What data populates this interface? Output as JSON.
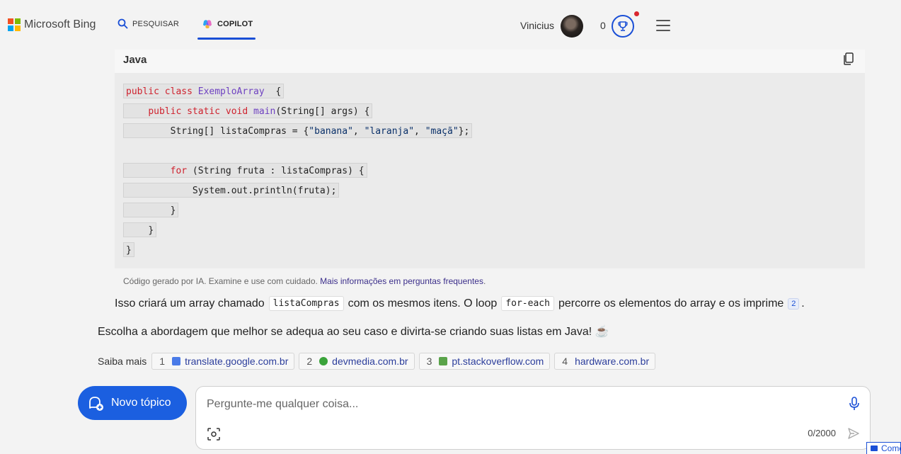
{
  "header": {
    "brand": "Microsoft Bing",
    "tabs": [
      {
        "label": "PESQUISAR",
        "active": false
      },
      {
        "label": "COPILOT",
        "active": true
      }
    ],
    "user_name": "Vinicius",
    "points": "0",
    "accent_color": "#1a4fd6"
  },
  "code_block": {
    "language": "Java",
    "lines": [
      {
        "indent": "",
        "parts": [
          [
            "kw",
            "public class "
          ],
          [
            "ty",
            "ExemploArray"
          ],
          [
            "",
            "  {"
          ]
        ]
      },
      {
        "indent": "    ",
        "parts": [
          [
            "kw",
            "public static void "
          ],
          [
            "ty",
            "main"
          ],
          [
            "",
            "(String[] args) {"
          ]
        ]
      },
      {
        "indent": "        ",
        "parts": [
          [
            "",
            "String[] listaCompras = {"
          ],
          [
            "st",
            "\"banana\""
          ],
          [
            "",
            ", "
          ],
          [
            "st",
            "\"laranja\""
          ],
          [
            "",
            ", "
          ],
          [
            "st",
            "\"maçã\""
          ],
          [
            "",
            "};"
          ]
        ]
      },
      {
        "indent": "",
        "parts": []
      },
      {
        "indent": "        ",
        "parts": [
          [
            "kw",
            "for"
          ],
          [
            "",
            " (String fruta : listaCompras) {"
          ]
        ]
      },
      {
        "indent": "            ",
        "parts": [
          [
            "",
            "System.out.println(fruta);"
          ]
        ]
      },
      {
        "indent": "        ",
        "parts": [
          [
            "",
            "}"
          ]
        ]
      },
      {
        "indent": "    ",
        "parts": [
          [
            "",
            "}"
          ]
        ]
      },
      {
        "indent": "",
        "parts": [
          [
            "",
            "}"
          ]
        ]
      }
    ]
  },
  "disclaimer": {
    "text": "Código gerado por IA. Examine e use com cuidado. ",
    "link": "Mais informações em perguntas frequentes"
  },
  "paragraph1": {
    "before": "Isso criará um array chamado",
    "code1": "listaCompras",
    "middle": "com os mesmos itens. O loop",
    "code2": "for-each",
    "after": "percorre os elementos do array e os imprime",
    "citation": "2",
    "end": "."
  },
  "paragraph2": "Escolha a abordagem que melhor se adequa ao seu caso e divirta-se criando suas listas em Java! ☕",
  "learn_more": {
    "label": "Saiba mais",
    "sources": [
      {
        "num": "1",
        "domain": "translate.google.com.br",
        "icon": "google-translate-icon",
        "color": "#4a7be8"
      },
      {
        "num": "2",
        "domain": "devmedia.com.br",
        "icon": "devmedia-icon",
        "color": "#3aa33a"
      },
      {
        "num": "3",
        "domain": "pt.stackoverflow.com",
        "icon": "stackoverflow-icon",
        "color": "#5aa34a"
      },
      {
        "num": "4",
        "domain": "hardware.com.br",
        "icon": "",
        "color": ""
      }
    ]
  },
  "new_topic": {
    "label": "Novo tópico"
  },
  "composer": {
    "placeholder": "Pergunte-me qualquer coisa...",
    "value": "",
    "counter": "0/2000"
  },
  "feedback": {
    "label": "Comentários"
  }
}
